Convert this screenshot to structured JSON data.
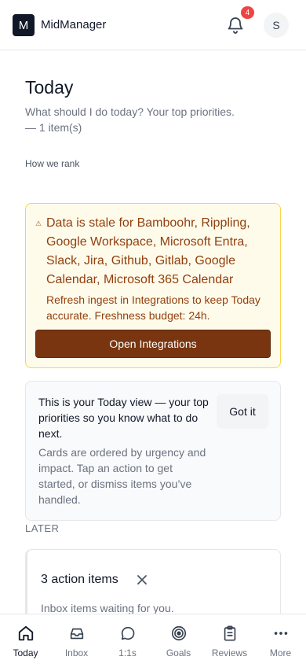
{
  "header": {
    "logo_letter": "M",
    "app_name": "MidManager",
    "notification_count": "4",
    "avatar_initial": "S"
  },
  "today": {
    "title": "Today",
    "subtitle": "What should I do today? Your top priorities.",
    "count": "— 1 item(s)",
    "how_we_rank": "How we rank"
  },
  "stale_alert": {
    "title": "Data is stale for Bamboohr, Rippling, Google Workspace, Microsoft Entra, Slack, Jira, Github, Gitlab, Google Calendar, Microsoft 365 Calendar",
    "body": "Refresh ingest in Integrations to keep Today accurate. Freshness budget: 24h.",
    "button_label": "Open Integrations"
  },
  "intro": {
    "title": "This is your Today view — your top priorities so you know what to do next.",
    "body": "Cards are ordered by urgency and impact. Tap an action to get started, or dismiss items you’ve handled.",
    "button_label": "Got it"
  },
  "later": {
    "label": "LATER",
    "card_title": "3 action items",
    "card_subtitle": "Inbox items waiting for you."
  },
  "tabbar": {
    "items": [
      {
        "label": "Today",
        "icon": "home-icon",
        "active": true
      },
      {
        "label": "Inbox",
        "icon": "inbox-icon",
        "active": false
      },
      {
        "label": "1:1s",
        "icon": "chat-bubble-icon",
        "active": false
      },
      {
        "label": "Goals",
        "icon": "target-icon",
        "active": false
      },
      {
        "label": "Reviews",
        "icon": "clipboard-icon",
        "active": false
      },
      {
        "label": "More",
        "icon": "more-dots-icon",
        "active": false
      }
    ]
  },
  "colors": {
    "alert_bg": "#fffbeb",
    "alert_border": "#fcd34d",
    "alert_text": "#92400e",
    "alert_button": "#78350f",
    "badge": "#ef4444"
  }
}
